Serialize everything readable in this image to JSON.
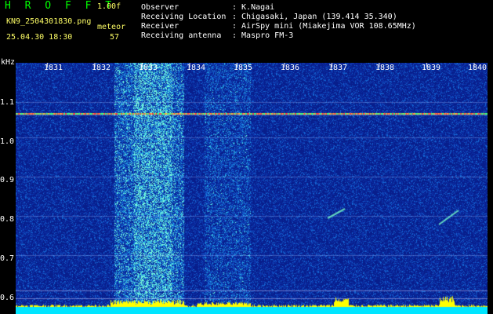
{
  "header": {
    "title": "H R O F F T",
    "version": "1.00f",
    "filename": "KN9_2504301830.png",
    "meteor_label": "meteor",
    "datetime": "25.04.30 18:30",
    "meteor_count": "57",
    "fields": [
      {
        "label": "Observer",
        "value": ": K.Nagai"
      },
      {
        "label": "Receiving Location",
        "value": ": Chigasaki, Japan (139.414 35.340)"
      },
      {
        "label": "Receiver",
        "value": ": AirSpy mini (Miakejima VOR 108.65MHz)"
      },
      {
        "label": "Receiving antenna",
        "value": ": Maspro FM-3"
      }
    ]
  },
  "spectrogram": {
    "y_unit": "kHz",
    "y_ticks": [
      "1.1",
      "1.0",
      "0.9",
      "0.8",
      "0.7",
      "0.6"
    ],
    "x_ticks": [
      "1831",
      "1832",
      "1833",
      "1834",
      "1835",
      "1836",
      "1837",
      "1838",
      "1839",
      "1840"
    ]
  },
  "colors": {
    "background": "#000000",
    "title_green": "#00ff00",
    "label_yellow": "#ffff66",
    "spectrum_base": "#0a1f9e",
    "carrier_line": "#ff4040",
    "meteor_bar": "#ffff00",
    "baseline": "#00e5ff"
  }
}
